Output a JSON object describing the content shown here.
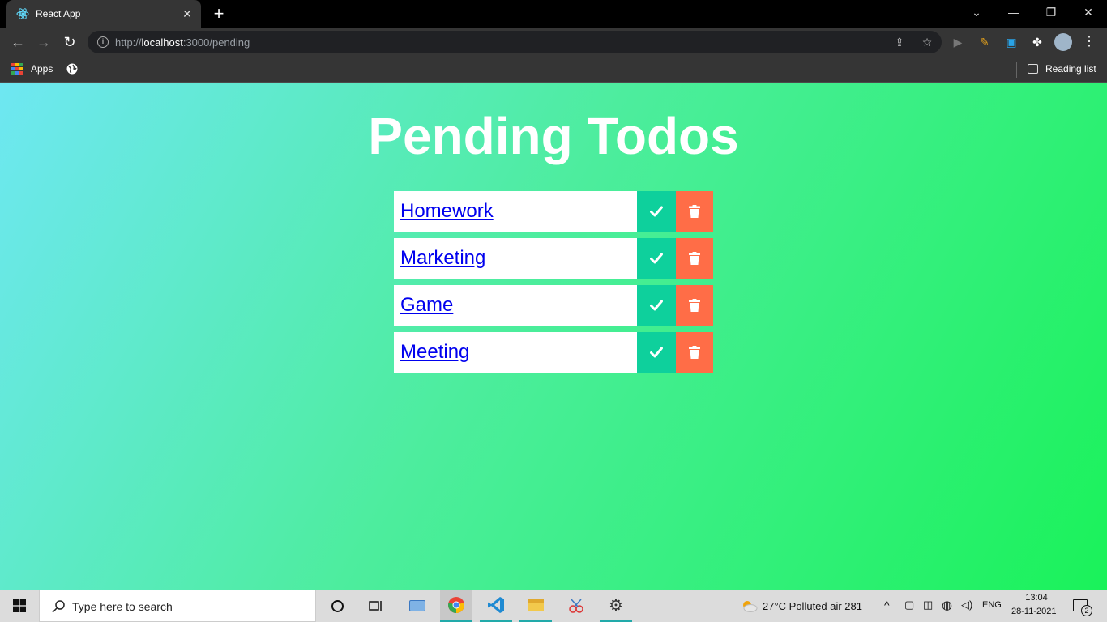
{
  "browser": {
    "tab_title": "React App",
    "url_host": "localhost",
    "url_prefix": "http://",
    "url_suffix": ":3000/pending",
    "bookmarks": {
      "apps_label": "Apps",
      "reading_list_label": "Reading list"
    }
  },
  "page": {
    "title": "Pending Todos",
    "todos": [
      {
        "label": "Homework"
      },
      {
        "label": "Marketing"
      },
      {
        "label": "Game"
      },
      {
        "label": "Meeting"
      }
    ],
    "colors": {
      "complete_button": "#0ed09c",
      "delete_button": "#ff6d47",
      "gradient_start": "#6ee7f2",
      "gradient_end": "#1af25a"
    }
  },
  "taskbar": {
    "search_placeholder": "Type here to search",
    "weather": "27°C  Polluted air 281",
    "language": "ENG",
    "time": "13:04",
    "date": "28-11-2021",
    "notification_count": "2"
  }
}
